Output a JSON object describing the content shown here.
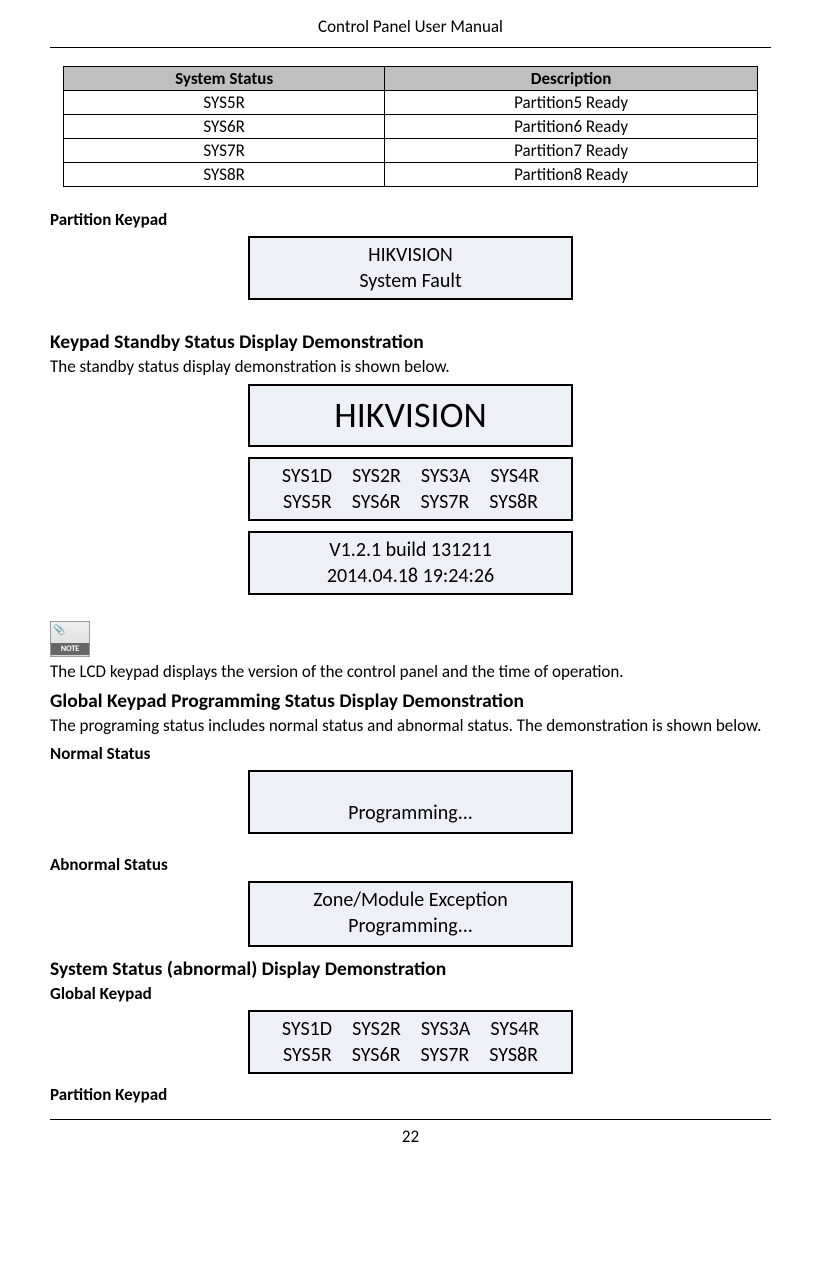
{
  "header": "Control Panel User Manual",
  "table": {
    "headers": [
      "System Status",
      "Description"
    ],
    "rows": [
      [
        "SYS5R",
        "Partition5 Ready"
      ],
      [
        "SYS6R",
        "Partition6 Ready"
      ],
      [
        "SYS7R",
        "Partition7 Ready"
      ],
      [
        "SYS8R",
        "Partition8 Ready"
      ]
    ]
  },
  "partition_keypad_label": "Partition Keypad",
  "partition_keypad_lcd": {
    "line1": "HIKVISION",
    "line2": "System Fault"
  },
  "standby": {
    "heading": "Keypad Standby Status Display Demonstration",
    "intro": "The standby status display demonstration is shown below.",
    "lcd_big": "HIKVISION",
    "lcd_status": {
      "line1": "SYS1D SYS2R SYS3A SYS4R",
      "line2": "SYS5R SYS6R SYS7R SYS8R"
    },
    "lcd_version": {
      "line1": "V1.2.1  build  131211",
      "line2": "2014.04.18  19:24:26"
    }
  },
  "note_label": "NOTE",
  "note_text": "The LCD keypad displays the version of the control panel and the time of operation.",
  "global_prog": {
    "heading": "Global Keypad Programming Status Display Demonstration",
    "intro": "The programing status includes normal status and abnormal status. The demonstration is shown below.",
    "normal_label": "Normal Status",
    "normal_lcd": "Programming...",
    "abnormal_label": "Abnormal Status",
    "abnormal_lcd": {
      "line1": "Zone/Module Exception",
      "line2": "Programming..."
    }
  },
  "abn_status": {
    "heading": "System Status (abnormal) Display Demonstration",
    "global_label": "Global Keypad",
    "global_lcd": {
      "line1": "SYS1D SYS2R SYS3A SYS4R",
      "line2": "SYS5R SYS6R SYS7R SYS8R"
    },
    "partition_label": "Partition Keypad"
  },
  "page_number": "22"
}
